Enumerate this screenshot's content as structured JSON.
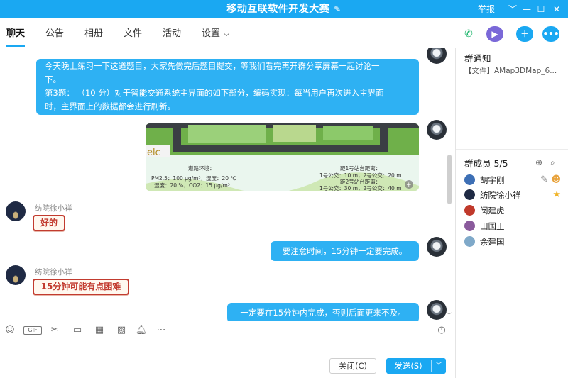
{
  "window": {
    "title": "移动互联软件开发大赛",
    "report_label": "举报",
    "controls": [
      "﹀",
      "—",
      "☐",
      "✕"
    ]
  },
  "tabs": [
    "聊天",
    "公告",
    "相册",
    "文件",
    "活动",
    "设置 ⌵"
  ],
  "actions": {
    "phone_icon": "phone-icon",
    "video_icon": "video-icon",
    "share_icon": "screen-share-icon",
    "more_icon": "more-icon"
  },
  "messages": {
    "m1": {
      "lines": [
        "今天晚上练习一下这道题目，大家先做完后题目提交，等我们看完再开群分享屏幕一起讨论一",
        "下。",
        "第3题：  （10 分）对于智能交通系统主界面的如下部分，编码实现：每当用户再次进入主界面",
        "时，主界面上的数据都会进行刷新。"
      ]
    },
    "image": {
      "elc": "elc",
      "env_title": "道路环境：",
      "env_line1": "PM2.5：100 μg/m³，湿度：20 ℃",
      "env_line2": "湿度：20 %，CO2：15 μg/m³",
      "stop1_title": "距1号站台距离：",
      "stop1_line": "1号公交：10 m，2号公交：20 m",
      "stop2_title": "距2号站台距离：",
      "stop2_line": "1号公交：30 m，2号公交：40 m"
    },
    "m2": {
      "sender": "纺院徐小祥",
      "sticker": "好的"
    },
    "m3": {
      "text": "要注意时间，15分钟一定要完成。"
    },
    "m4": {
      "sender": "纺院徐小祥",
      "sticker": "15分钟可能有点困难"
    },
    "m5": {
      "text": "一定要在15分钟内完成，否则后面更来不及。"
    }
  },
  "buttons": {
    "close": "关闭(C)",
    "send": "发送(S)"
  },
  "notice": {
    "title": "群通知",
    "body": "【文件】AMap3DMap_6..."
  },
  "members": {
    "title": "群成员 5/5",
    "list": [
      {
        "name": "胡宇刚",
        "color": "#3d6fb5"
      },
      {
        "name": "纺院徐小祥",
        "color": "#1f2a44"
      },
      {
        "name": "闵建虎",
        "color": "#c0392b"
      },
      {
        "name": "田国正",
        "color": "#8a5a9c"
      },
      {
        "name": "余建国",
        "color": "#7fa9c9"
      }
    ]
  },
  "colors": {
    "accent": "#1aa8f2",
    "bubble": "#2eb1f3",
    "sticker": "#c23b2f"
  }
}
